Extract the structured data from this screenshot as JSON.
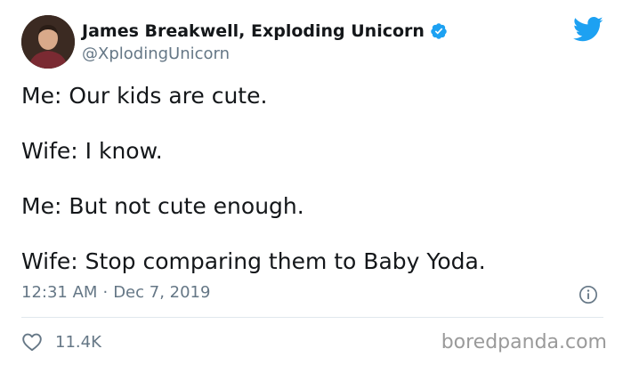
{
  "author": {
    "display_name": "James Breakwell, Exploding Unicorn",
    "handle": "@XplodingUnicorn",
    "verified": true
  },
  "tweet": {
    "lines": [
      "Me: Our kids are cute.",
      "Wife: I know.",
      "Me: But not cute enough.",
      "Wife: Stop comparing them to Baby Yoda."
    ],
    "time": "12:31 AM",
    "separator": "·",
    "date": "Dec 7, 2019"
  },
  "engagement": {
    "likes": "11.4K"
  },
  "watermark": "boredpanda.com",
  "icons": {
    "brand": "twitter-bird-icon",
    "verified": "verified-badge-icon",
    "info": "info-icon",
    "like": "heart-icon"
  },
  "colors": {
    "twitter_blue": "#1DA1F2",
    "text_primary": "#14171A",
    "text_secondary": "#657786",
    "divider": "#E1E8ED",
    "watermark": "#9A9A9A"
  }
}
